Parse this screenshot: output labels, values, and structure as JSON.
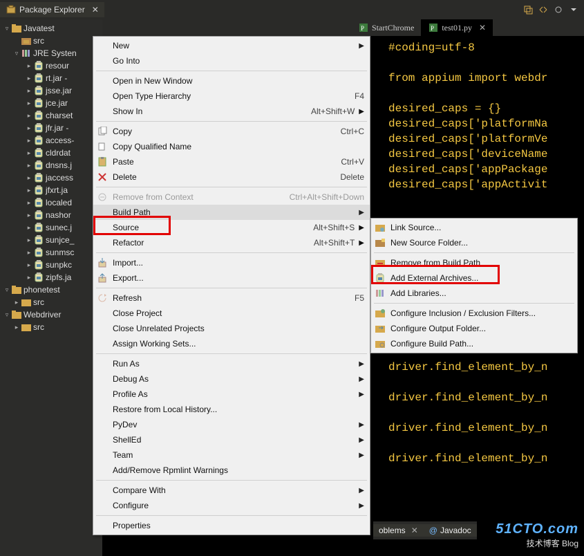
{
  "header": {
    "view_tab": "Package Explorer"
  },
  "tree": {
    "proj1": "Javatest",
    "src1": "src",
    "jre": "JRE Systen",
    "jars": [
      "resour",
      "rt.jar -",
      "jsse.jar",
      "jce.jar",
      "charset",
      "jfr.jar -",
      "access-",
      "cldrdat",
      "dnsns.j",
      "jaccess",
      "jfxrt.ja",
      "localed",
      "nashor",
      "sunec.j",
      "sunjce_",
      "sunmsc",
      "sunpkc",
      "zipfs.ja"
    ],
    "proj2": "phonetest",
    "src2": "src",
    "proj3": "Webdriver",
    "src3": "src"
  },
  "editor": {
    "tab1": "StartChrome",
    "tab2": "test01.py",
    "lines": [
      "#coding=utf-8",
      "",
      "from appium import webdr",
      "",
      "desired_caps = {}",
      "desired_caps['platformNa",
      "desired_caps['platformVe",
      "desired_caps['deviceName",
      "desired_caps['appPackage",
      "desired_caps['appActivit",
      "",
      "",
      "",
      "",
      "",
      "",
      "",
      "",
      "",
      "",
      "",
      "driver.find_element_by_n",
      "",
      "driver.find_element_by_n",
      "",
      "driver.find_element_by_n",
      "",
      "driver.find_element_by_n"
    ]
  },
  "menu": {
    "new": "New",
    "go_into": "Go Into",
    "open_window": "Open in New Window",
    "open_type": "Open Type Hierarchy",
    "open_type_key": "F4",
    "show_in": "Show In",
    "show_in_key": "Alt+Shift+W",
    "copy": "Copy",
    "copy_key": "Ctrl+C",
    "copy_qn": "Copy Qualified Name",
    "paste": "Paste",
    "paste_key": "Ctrl+V",
    "delete": "Delete",
    "delete_key": "Delete",
    "remove_ctx": "Remove from Context",
    "remove_ctx_key": "Ctrl+Alt+Shift+Down",
    "build_path": "Build Path",
    "source": "Source",
    "source_key": "Alt+Shift+S",
    "refactor": "Refactor",
    "refactor_key": "Alt+Shift+T",
    "import": "Import...",
    "export": "Export...",
    "refresh": "Refresh",
    "refresh_key": "F5",
    "close_proj": "Close Project",
    "close_unrel": "Close Unrelated Projects",
    "assign_ws": "Assign Working Sets...",
    "run_as": "Run As",
    "debug_as": "Debug As",
    "profile_as": "Profile As",
    "restore": "Restore from Local History...",
    "pydev": "PyDev",
    "shelled": "ShellEd",
    "team": "Team",
    "rpmlint": "Add/Remove Rpmlint Warnings",
    "compare": "Compare With",
    "configure": "Configure",
    "properties": "Properties"
  },
  "submenu": {
    "link_source": "Link Source...",
    "new_source_folder": "New Source Folder...",
    "remove_bp": "Remove from Build Path",
    "add_ext": "Add External Archives...",
    "add_lib": "Add Libraries...",
    "conf_filters": "Configure Inclusion / Exclusion Filters...",
    "conf_output": "Configure Output Folder...",
    "conf_bp": "Configure Build Path..."
  },
  "bottom": {
    "problems": "oblems",
    "javadoc": "Javadoc"
  },
  "watermark": {
    "l1": "51CTO.com",
    "l2": "技术博客  Blog"
  }
}
